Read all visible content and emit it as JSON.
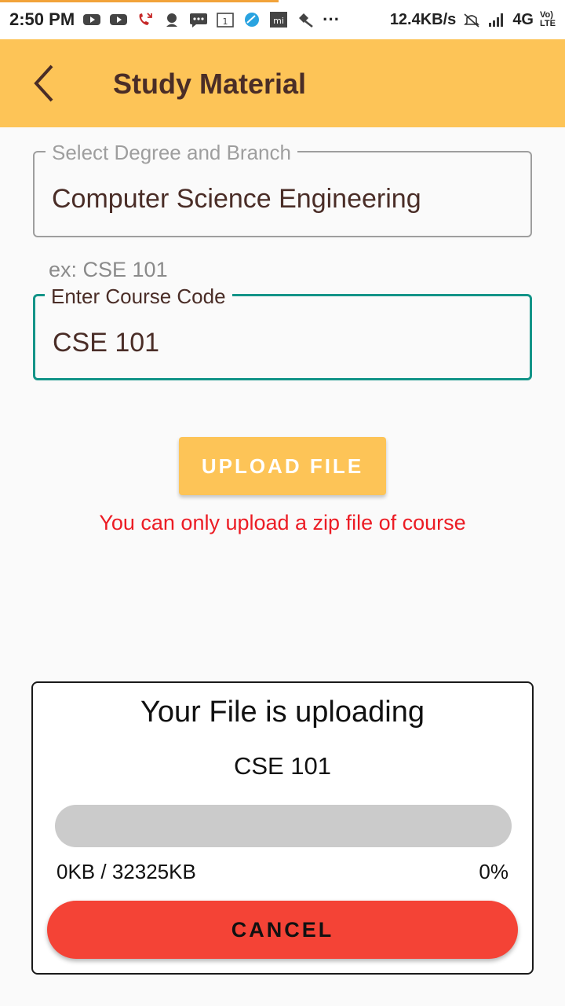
{
  "status_bar": {
    "time": "2:50 PM",
    "net_speed": "12.4KB/s",
    "network": "4G",
    "volte": "Vo) LTE",
    "dots": "···"
  },
  "app_bar": {
    "title": "Study Material",
    "back_icon": "back-arrow-icon"
  },
  "form": {
    "degree_field": {
      "label": "Select Degree and Branch",
      "value": "Computer Science Engineering"
    },
    "course_hint": "ex: CSE 101",
    "course_field": {
      "label": "Enter Course Code",
      "value": "CSE 101"
    },
    "upload_button": "UPLOAD FILE",
    "warning": "You can only upload a zip file of course"
  },
  "upload_dialog": {
    "title": "Your File is uploading",
    "course_code": "CSE 101",
    "progress_percent": 0,
    "size_text": "0KB / 32325KB",
    "percent_text": "0%",
    "cancel_button": "CANCEL"
  },
  "colors": {
    "app_bar": "#fdc457",
    "title_text": "#4a2d27",
    "focus_border": "#139488",
    "warning": "#ec1c24",
    "cancel": "#f44336",
    "progress_track": "#cbcbcb"
  }
}
